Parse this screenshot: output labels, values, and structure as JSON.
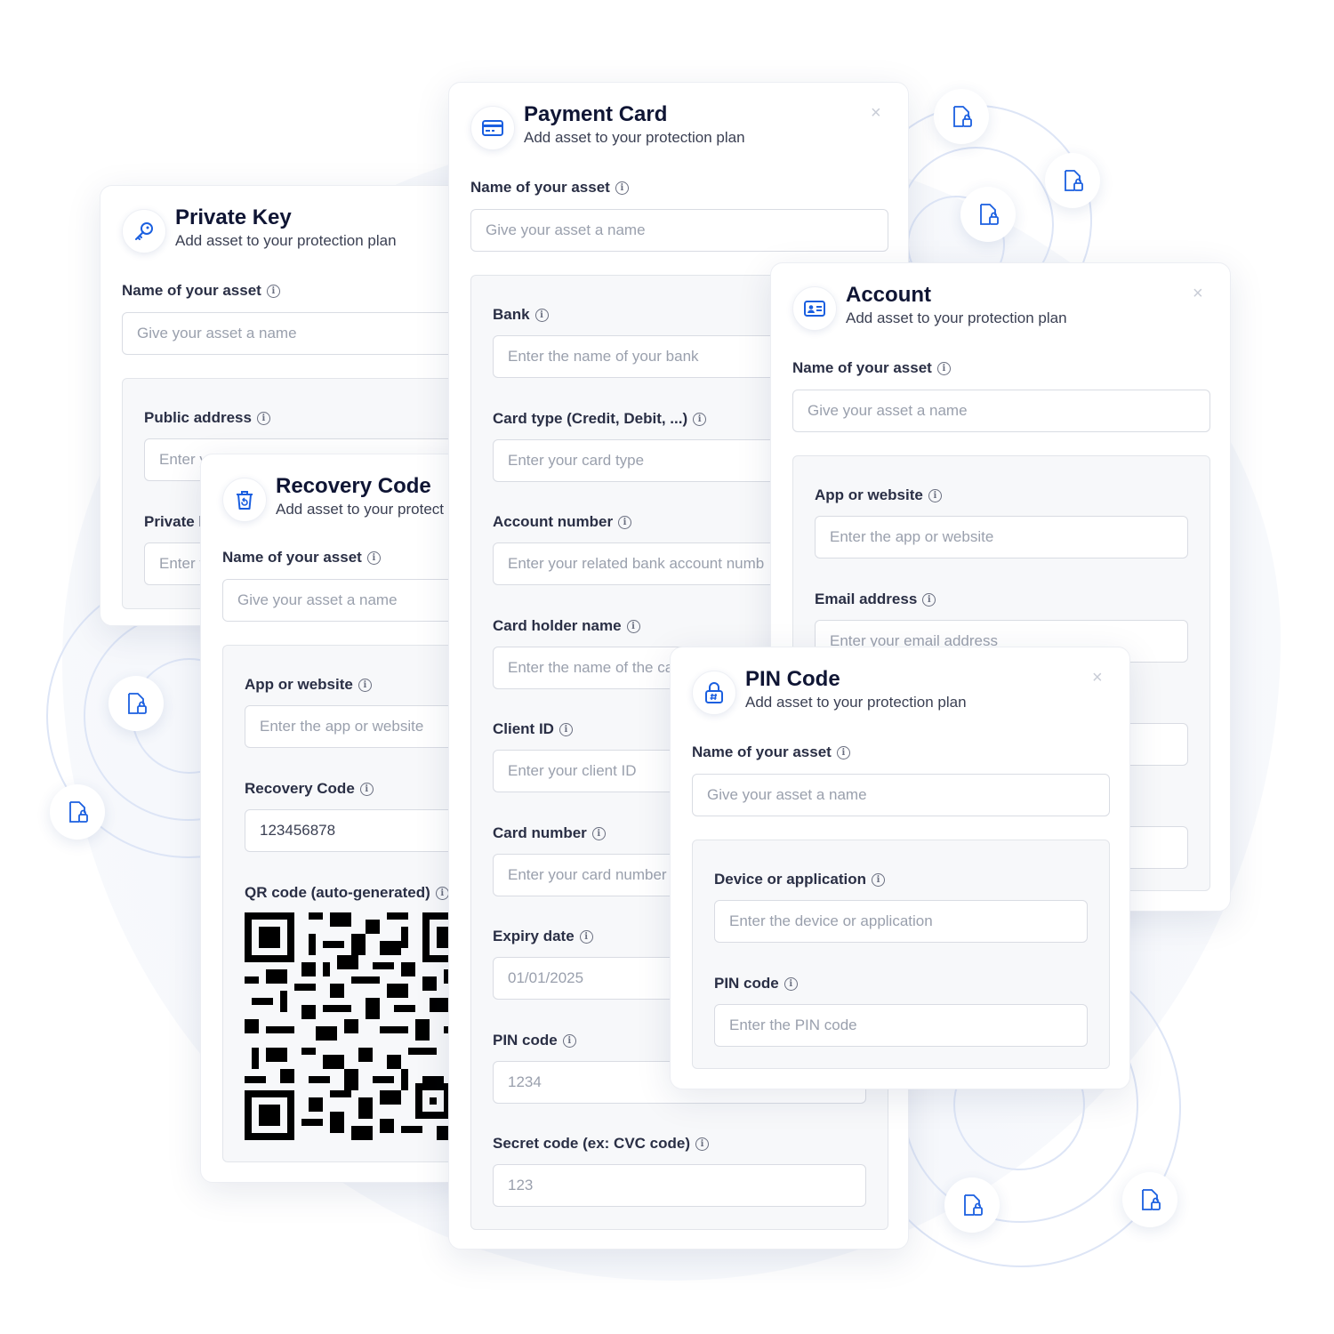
{
  "common": {
    "subtitle": "Add asset to your protection plan",
    "name_label": "Name of your asset",
    "name_placeholder": "Give your asset a name",
    "close": "×",
    "info": "i"
  },
  "private_key": {
    "title": "Private Key",
    "public_address_label": "Public address",
    "public_address_placeholder": "Enter y",
    "private_label": "Private k",
    "private_placeholder": "Enter y"
  },
  "recovery_code": {
    "title": "Recovery Code",
    "subtitle": "Add asset to your protect",
    "app_label": "App or website",
    "app_placeholder": "Enter the app or website",
    "code_label": "Recovery Code",
    "code_value": "123456878",
    "qr_label": "QR code (auto-generated)"
  },
  "payment_card": {
    "title": "Payment Card",
    "bank_label": "Bank",
    "bank_placeholder": "Enter the name of your bank",
    "card_type_label": "Card type (Credit, Debit, ...)",
    "card_type_placeholder": "Enter your card type",
    "account_number_label": "Account number",
    "account_number_placeholder": "Enter your related bank account numb",
    "holder_label": "Card holder name",
    "holder_placeholder": "Enter the name of the ca",
    "client_id_label": "Client ID",
    "client_id_placeholder": "Enter your client ID",
    "card_number_label": "Card number",
    "card_number_placeholder": "Enter your card number",
    "expiry_label": "Expiry date",
    "expiry_placeholder": "01/01/2025",
    "pin_label": "PIN code",
    "pin_placeholder": "1234",
    "secret_label": "Secret code (ex: CVC code)",
    "secret_placeholder": "123"
  },
  "account": {
    "title": "Account",
    "app_label": "App or website",
    "app_placeholder": "Enter the app or website",
    "email_label": "Email address",
    "email_placeholder": "Enter your email address"
  },
  "pin_code": {
    "title": "PIN Code",
    "device_label": "Device or application",
    "device_placeholder": "Enter the device or application",
    "pin_label": "PIN code",
    "pin_placeholder": "Enter the PIN code"
  },
  "colors": {
    "accent": "#1a5fe0",
    "ring": "#dde5f6"
  },
  "icons": [
    "key-icon",
    "credit-card-icon",
    "id-card-icon",
    "recycle-bin-icon",
    "lock-hash-icon",
    "document-lock-icon"
  ]
}
